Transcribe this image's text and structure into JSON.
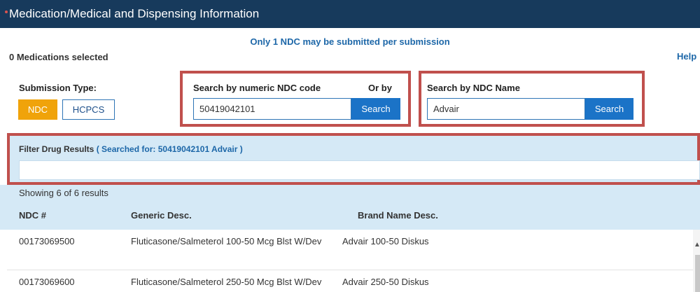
{
  "header": {
    "title": "Medication/Medical and Dispensing Information"
  },
  "notice": "Only 1 NDC may be submitted per submission",
  "meds_selected": "0 Medications selected",
  "help_link": "Help",
  "submission": {
    "label": "Submission Type:",
    "ndc": "NDC",
    "hcpcs": "HCPCS"
  },
  "search_code": {
    "label": "Search by numeric NDC code",
    "or_by": "Or by",
    "value": "50419042101",
    "button": "Search"
  },
  "search_name": {
    "label": "Search by NDC Name",
    "value": "Advair",
    "button": "Search"
  },
  "filter": {
    "label": "Filter Drug Results",
    "searched_for": "( Searched for: 50419042101 Advair )",
    "value": ""
  },
  "results": {
    "showing": "Showing 6 of 6 results",
    "columns": [
      "NDC #",
      "Generic Desc.",
      "Brand Name Desc."
    ],
    "rows": [
      {
        "ndc": "00173069500",
        "generic": "Fluticasone/Salmeterol 100-50 Mcg Blst W/Dev",
        "brand": "Advair 100-50 Diskus"
      },
      {
        "ndc": "00173069600",
        "generic": "Fluticasone/Salmeterol 250-50 Mcg Blst W/Dev",
        "brand": "Advair 250-50 Diskus"
      }
    ]
  },
  "colors": {
    "header": "#173a5c",
    "accent": "#1b73c7",
    "ndc_button": "#f0a30a",
    "highlight": "#c0504d",
    "band": "#d5e9f6"
  },
  "icons": {
    "scroll_up": "caret-up-icon"
  }
}
